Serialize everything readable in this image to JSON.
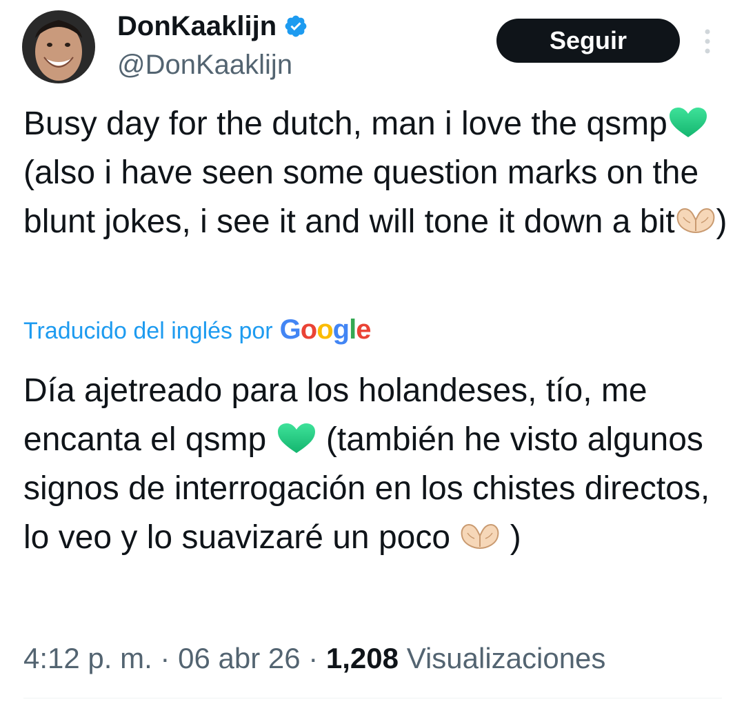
{
  "user": {
    "display_name": "DonKaaklijn",
    "handle": "@DonKaaklijn",
    "verified_icon": "verified-badge-icon",
    "verified_color": "#1d9bf0"
  },
  "follow_button": {
    "label": "Seguir"
  },
  "more_menu": {
    "icon": "more-vertical-icon"
  },
  "tweet": {
    "part1": "Busy day for the dutch, man i love the qsmp",
    "part2": " (also i have seen some question marks on the blunt jokes, i see it and will tone it down a bit",
    "part3": ")"
  },
  "translation": {
    "label": "Traducido del inglés por",
    "provider": "Google",
    "part1": "Día ajetreado para los holandeses, tío, me encanta el qsmp ",
    "part2": " (también he visto algunos signos de interrogación en los chistes directos, lo veo y lo suavizaré un poco ",
    "part3": " )"
  },
  "emojis": {
    "green_heart": "green-heart-emoji",
    "heart_hands": "heart-hands-emoji"
  },
  "meta": {
    "time": "4:12 p. m.",
    "separator": " · ",
    "date": "06 abr 26",
    "views_count": "1,208",
    "views_label": "Visualizaciones"
  },
  "colors": {
    "text": "#0f1419",
    "secondary": "#536471",
    "link": "#1d9bf0",
    "button_bg": "#0f1419",
    "button_text": "#ffffff"
  }
}
